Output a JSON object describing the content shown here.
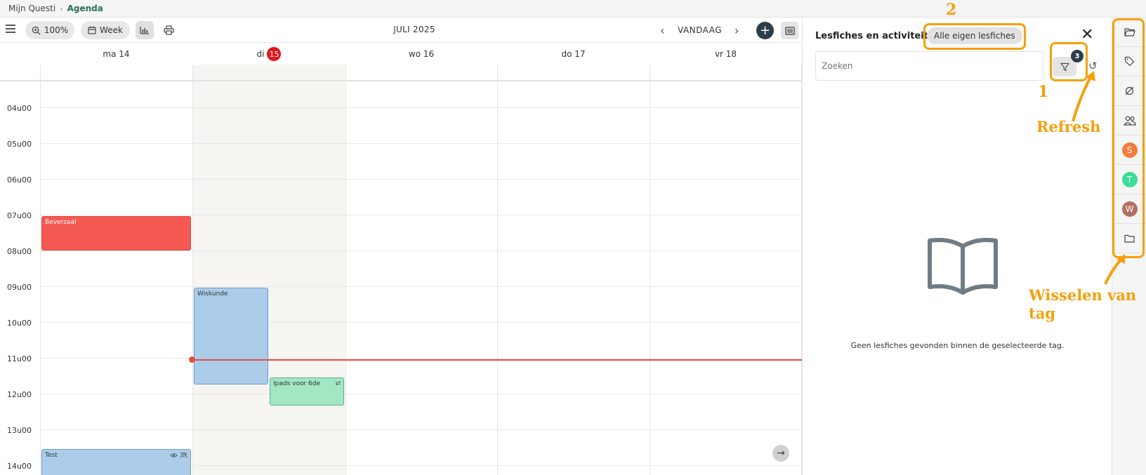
{
  "breadcrumb": {
    "root": "Mijn Questi",
    "current": "Agenda"
  },
  "toolbar": {
    "zoom_label": "100%",
    "view_label": "Week",
    "month_title": "JULI 2025",
    "today_label": "VANDAAG",
    "add_label": "+"
  },
  "days": [
    {
      "label": "ma 14"
    },
    {
      "label": "di",
      "badge": "15"
    },
    {
      "label": "wo 16"
    },
    {
      "label": "do 17"
    },
    {
      "label": "vr 18"
    }
  ],
  "hours": [
    "04u00",
    "05u00",
    "06u00",
    "07u00",
    "08u00",
    "09u00",
    "10u00",
    "11u00",
    "12u00",
    "13u00",
    "14u00"
  ],
  "events": [
    {
      "title": "Beverzaal",
      "day": "ma 14",
      "start": "07u00",
      "end": "08u00",
      "color": "#f55a52"
    },
    {
      "title": "Wiskunde",
      "day": "di 15",
      "start": "09u00",
      "end": "11u45",
      "color": "#abcdea"
    },
    {
      "title": "Ipads voor 6de",
      "day": "di 15",
      "start": "11u30",
      "end": "12u15",
      "color": "#a2e6c4",
      "icon": "repeat-icon"
    },
    {
      "title": "Test",
      "day": "ma 14",
      "start": "13u30",
      "end": "",
      "color": "#abcdea",
      "icons": [
        "eye-icon",
        "users-icon"
      ]
    }
  ],
  "panel": {
    "title": "Lesfiches en activiteiten",
    "tag_filter": "Alle eigen lesfiches",
    "search_placeholder": "Zoeken",
    "filter_count": "3",
    "empty_message": "Geen lesfiches gevonden binnen de geselecteerde tag."
  },
  "rail": {
    "items": [
      "folder-open-icon",
      "tag-icon",
      "no-tag-icon",
      "users-icon",
      "avatar-s",
      "avatar-t",
      "avatar-w",
      "folder-icon"
    ],
    "avatars": [
      {
        "letter": "S",
        "color": "#f47c3c"
      },
      {
        "letter": "T",
        "color": "#3ddc97"
      },
      {
        "letter": "W",
        "color": "#b07060"
      }
    ]
  },
  "annotations": {
    "label_1": "1",
    "label_2": "2",
    "refresh": "Refresh",
    "switch_tag": "Wisselen van tag",
    "color": "#f5a00a"
  }
}
